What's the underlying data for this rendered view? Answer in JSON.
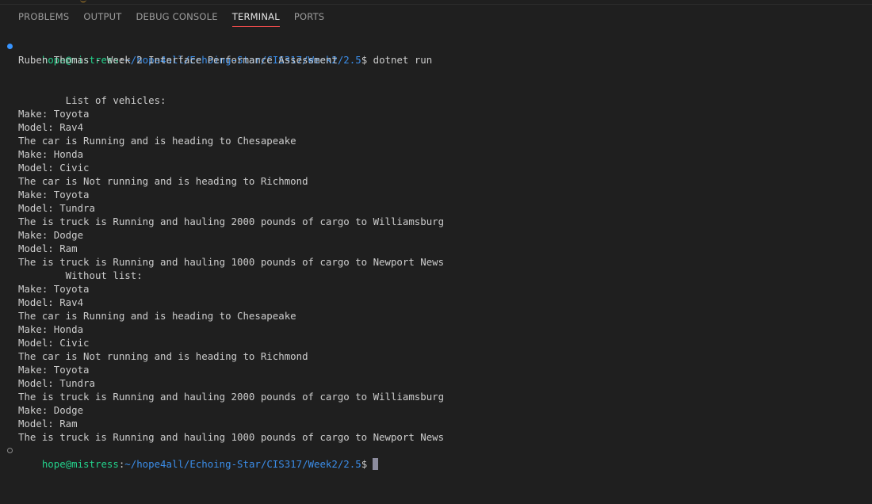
{
  "panel": {
    "tabs": [
      {
        "label": "PROBLEMS",
        "active": false
      },
      {
        "label": "OUTPUT",
        "active": false
      },
      {
        "label": "DEBUG CONSOLE",
        "active": false
      },
      {
        "label": "TERMINAL",
        "active": true
      },
      {
        "label": "PORTS",
        "active": false
      }
    ]
  },
  "terminal": {
    "prompt1": {
      "user_host": "hope@mistress",
      "colon": ":",
      "path": "~/hope4all/Echoing-Star/CIS317/Week2/2.5",
      "symbol": "$",
      "command": " dotnet run"
    },
    "output": [
      "Ruben Thomas - Week 2 Interface Performance Assessment",
      "",
      "",
      "        List of vehicles:",
      "Make: Toyota",
      "Model: Rav4",
      "The car is Running and is heading to Chesapeake",
      "Make: Honda",
      "Model: Civic",
      "The car is Not running and is heading to Richmond",
      "Make: Toyota",
      "Model: Tundra",
      "The is truck is Running and hauling 2000 pounds of cargo to Williamsburg",
      "Make: Dodge",
      "Model: Ram",
      "The is truck is Running and hauling 1000 pounds of cargo to Newport News",
      "        Without list:",
      "Make: Toyota",
      "Model: Rav4",
      "The car is Running and is heading to Chesapeake",
      "Make: Honda",
      "Model: Civic",
      "The car is Not running and is heading to Richmond",
      "Make: Toyota",
      "Model: Tundra",
      "The is truck is Running and hauling 2000 pounds of cargo to Williamsburg",
      "Make: Dodge",
      "Model: Ram",
      "The is truck is Running and hauling 1000 pounds of cargo to Newport News"
    ],
    "prompt2": {
      "user_host": "hope@mistress",
      "colon": ":",
      "path": "~/hope4all/Echoing-Star/CIS317/Week2/2.5",
      "symbol": "$",
      "command": ""
    }
  }
}
